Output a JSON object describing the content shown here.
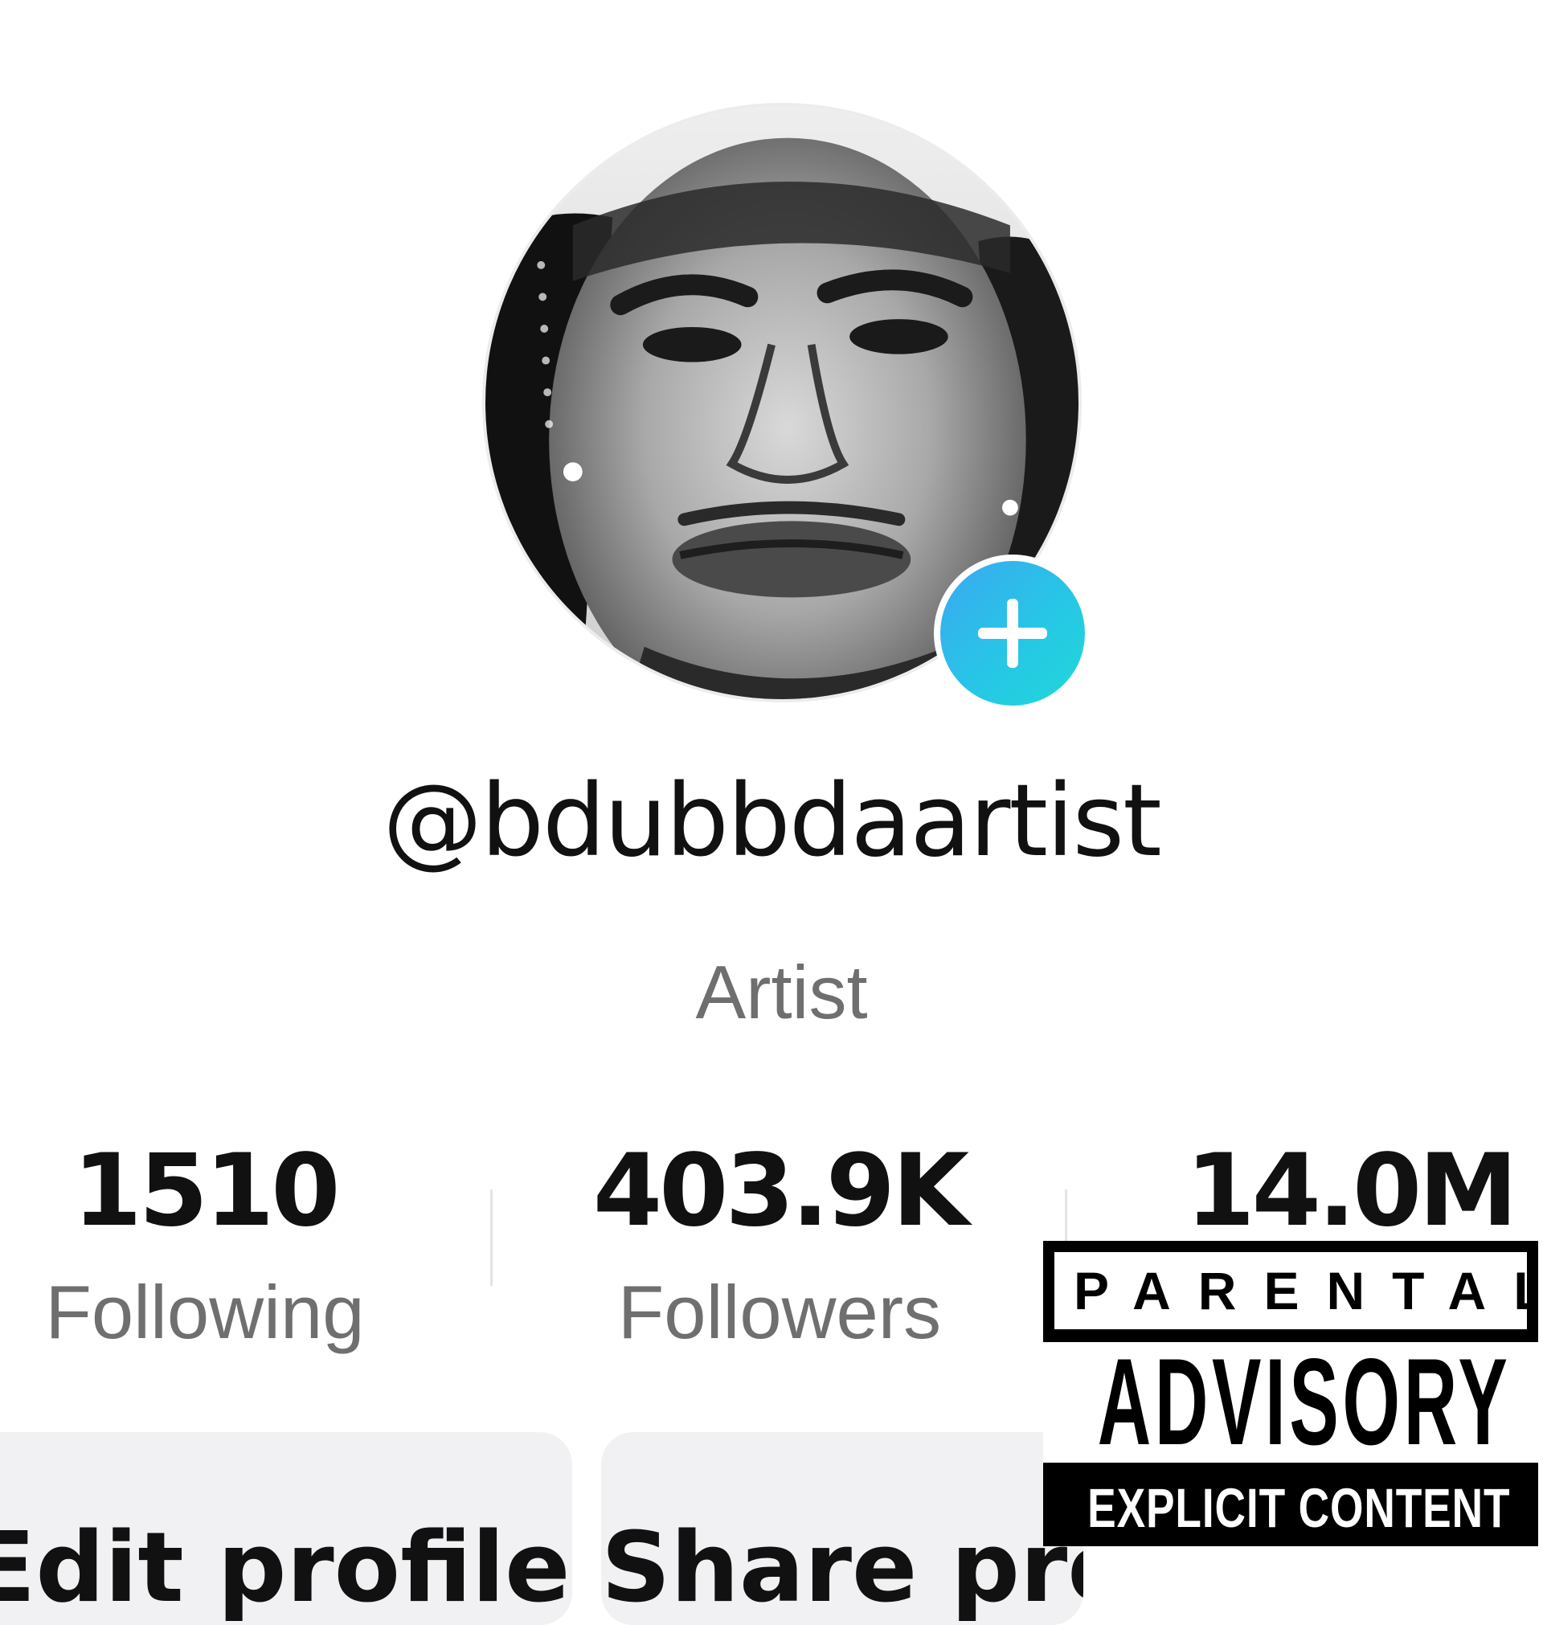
{
  "profile": {
    "username": "@bdubbdaartist",
    "bio_role": "Artist"
  },
  "stats": {
    "following": {
      "value": "1510",
      "label": "Following"
    },
    "followers": {
      "value": "403.9K",
      "label": "Followers"
    },
    "likes": {
      "value": "14.0M"
    }
  },
  "actions": {
    "edit_profile_label": "Edit profile",
    "share_profile_label": "Share profile"
  },
  "advisory": {
    "line1": "PARENTAL",
    "line2": "ADVISORY",
    "line3": "EXPLICIT CONTENT"
  },
  "icons": {
    "add_badge": "plus-icon",
    "avatar": "profile-photo"
  },
  "colors": {
    "add_badge_gradient_start": "#3aa9f0",
    "add_badge_gradient_end": "#1fd8d8",
    "text_primary": "#111111",
    "text_secondary": "#6f6f6f",
    "button_bg": "#f1f1f3"
  }
}
